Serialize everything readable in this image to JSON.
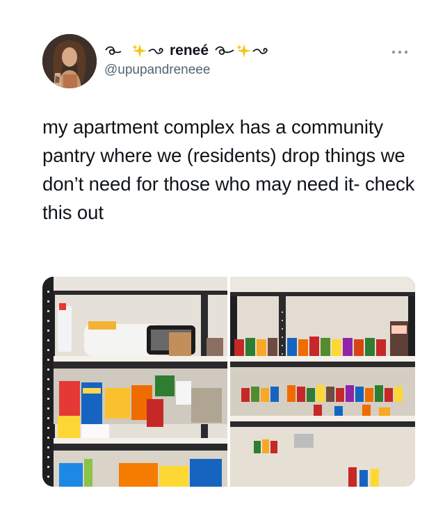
{
  "tweet": {
    "display_name": "reneé",
    "handle": "@upupandreneee",
    "text": "my apartment complex has a community pantry where we (residents) drop things we don’t need for those who may need it- check this out"
  },
  "media": {
    "photos": [
      {
        "name": "pantry-photo-left"
      },
      {
        "name": "pantry-photo-right"
      }
    ]
  },
  "icons": {
    "more": "more-options-icon",
    "sparkles": "sparkles-icon",
    "swirl": "swirl-ornament-icon"
  }
}
